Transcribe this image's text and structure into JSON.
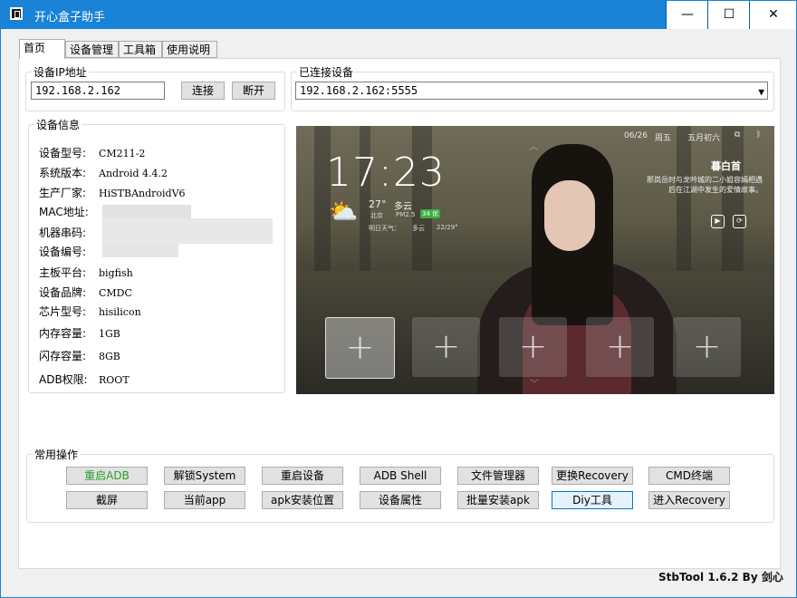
{
  "window": {
    "title": "开心盒子助手",
    "buttons": {
      "minimize": "—",
      "maximize": "☐",
      "close": "✕"
    }
  },
  "tabs": [
    {
      "label": "首页",
      "active": true
    },
    {
      "label": "设备管理",
      "active": false
    },
    {
      "label": "工具箱",
      "active": false
    },
    {
      "label": "使用说明",
      "active": false
    }
  ],
  "ip_group": {
    "legend": "设备IP地址",
    "ip_value": "192.168.2.162",
    "connect_label": "连接",
    "disconnect_label": "断开"
  },
  "connected_group": {
    "legend": "已连接设备",
    "selected": "192.168.2.162:5555"
  },
  "device_info": {
    "legend": "设备信息",
    "rows": [
      {
        "label": "设备型号:",
        "value": "CM211-2"
      },
      {
        "label": "系统版本:",
        "value": "Android 4.4.2"
      },
      {
        "label": "生产厂家:",
        "value": "HiSTBAndroidV6"
      },
      {
        "label": "MAC地址:",
        "value": ""
      },
      {
        "label": "机器串码:",
        "value": ""
      },
      {
        "label": "设备编号:",
        "value": ""
      },
      {
        "label": "主板平台:",
        "value": "bigfish"
      },
      {
        "label": "设备品牌:",
        "value": "CMDC"
      },
      {
        "label": "芯片型号:",
        "value": "hisilicon"
      },
      {
        "label": "内存容量:",
        "value": "1GB"
      },
      {
        "label": "闪存容量:",
        "value": "8GB"
      },
      {
        "label": "ADB权限:",
        "value": "ROOT"
      }
    ]
  },
  "device_screen": {
    "date": "06/26",
    "weekday": "周五",
    "lunar": "五月初六",
    "time": "17:23",
    "temperature": "27°",
    "weather": "多云",
    "city": "北京",
    "pm_label": "PM2.5",
    "pm_value": "34",
    "pm_level": "优",
    "tomorrow_label": "明日天气：",
    "tomorrow_weather": "多云",
    "tomorrow_range": "22/29°",
    "show_title": "暮白首",
    "show_desc": "那岚岳时与龙吟城的二小姐容嫣相遇后在江湖中发生的爱情故事。",
    "tile_glyph": "+"
  },
  "common_ops": {
    "legend": "常用操作",
    "row1": [
      "重启ADB",
      "解锁System",
      "重启设备",
      "ADB Shell",
      "文件管理器",
      "更换Recovery",
      "CMD终端"
    ],
    "row2": [
      "截屏",
      "当前app",
      "apk安装位置",
      "设备属性",
      "批量安装apk",
      "Diy工具",
      "进入Recovery"
    ]
  },
  "footer": "StbTool 1.6.2 By 剑心",
  "colors": {
    "titlebar": "#1883d7",
    "green_button_text": "#2b9e2b",
    "focus_border": "#0078d7"
  }
}
